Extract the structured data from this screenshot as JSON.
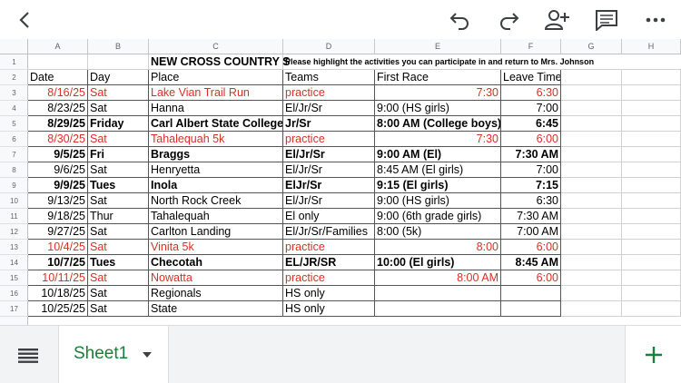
{
  "toolbar": {
    "icons": [
      "back-arrow-icon",
      "undo-icon",
      "redo-icon",
      "share-person-icon",
      "comment-icon",
      "more-icon"
    ]
  },
  "columns": [
    "A",
    "B",
    "C",
    "D",
    "E",
    "F",
    "G",
    "H"
  ],
  "rows": [
    "1",
    "2",
    "3",
    "4",
    "5",
    "6",
    "7",
    "8",
    "9",
    "10",
    "11",
    "12",
    "13",
    "14",
    "15",
    "16",
    "17"
  ],
  "sheet": {
    "title": "NEW CROSS COUNTRY S",
    "note": "Please highlight the activities you can participate in and return to Mrs. Johnson",
    "headers": {
      "date": "Date",
      "day": "Day",
      "place": "Place",
      "teams": "Teams",
      "first_race": "First Race",
      "leave_time": "Leave Time"
    },
    "events": [
      {
        "date": "8/16/25",
        "day": "Sat",
        "place": "Lake Vian Trail Run",
        "teams": "practice",
        "first_race": "7:30",
        "leave_time": "6:30"
      },
      {
        "date": "8/23/25",
        "day": "Sat",
        "place": "Hanna",
        "teams": "El/Jr/Sr",
        "first_race": "9:00 (HS girls)",
        "leave_time": "7:00"
      },
      {
        "date": "8/29/25",
        "day": "Friday",
        "place": "Carl Albert State College",
        "teams": "Jr/Sr",
        "first_race": "8:00 AM (College boys)",
        "leave_time": "6:45"
      },
      {
        "date": "8/30/25",
        "day": "Sat",
        "place": "Tahalequah 5k",
        "teams": "practice",
        "first_race": "7:30",
        "leave_time": "6:00"
      },
      {
        "date": "9/5/25",
        "day": "Fri",
        "place": "Braggs",
        "teams": "El/Jr/Sr",
        "first_race": "9:00 AM (El)",
        "leave_time": "7:30 AM"
      },
      {
        "date": "9/6/25",
        "day": "Sat",
        "place": "Henryetta",
        "teams": "El/Jr/Sr",
        "first_race": "8:45 AM (El girls)",
        "leave_time": "7:00"
      },
      {
        "date": "9/9/25",
        "day": "Tues",
        "place": "Inola",
        "teams": "ElJr/Sr",
        "first_race": "9:15 (El girls)",
        "leave_time": "7:15"
      },
      {
        "date": "9/13/25",
        "day": "Sat",
        "place": "North Rock Creek",
        "teams": "El/Jr/Sr",
        "first_race": "9:00 (HS girls)",
        "leave_time": "6:30"
      },
      {
        "date": "9/18/25",
        "day": "Thur",
        "place": "Tahalequah",
        "teams": "El only",
        "first_race": "9:00 (6th grade girls)",
        "leave_time": "7:30 AM"
      },
      {
        "date": "9/27/25",
        "day": "Sat",
        "place": "Carlton Landing",
        "teams": "El/Jr/Sr/Families",
        "first_race": "8:00 (5k)",
        "leave_time": "7:00 AM"
      },
      {
        "date": "10/4/25",
        "day": "Sat",
        "place": "Vinita 5k",
        "teams": "practice",
        "first_race": "8:00",
        "leave_time": "6:00"
      },
      {
        "date": "10/7/25",
        "day": "Tues",
        "place": "Checotah",
        "teams": "EL/JR/SR",
        "first_race": "10:00 (El girls)",
        "leave_time": "8:45 AM"
      },
      {
        "date": "10/11/25",
        "day": "Sat",
        "place": "Nowatta",
        "teams": "practice",
        "first_race": "8:00 AM",
        "leave_time": "6:00"
      },
      {
        "date": "10/18/25",
        "day": "Sat",
        "place": "Regionals",
        "teams": "HS only",
        "first_race": "",
        "leave_time": ""
      },
      {
        "date": "10/25/25",
        "day": "Sat",
        "place": "State",
        "teams": "HS only",
        "first_race": "",
        "leave_time": ""
      }
    ]
  },
  "bottom": {
    "sheet_tab_label": "Sheet1",
    "icons": [
      "sheets-list-icon",
      "dropdown-caret-icon",
      "add-sheet-icon"
    ]
  },
  "colors": {
    "accent": "#188038",
    "red_text": "#d93025"
  }
}
